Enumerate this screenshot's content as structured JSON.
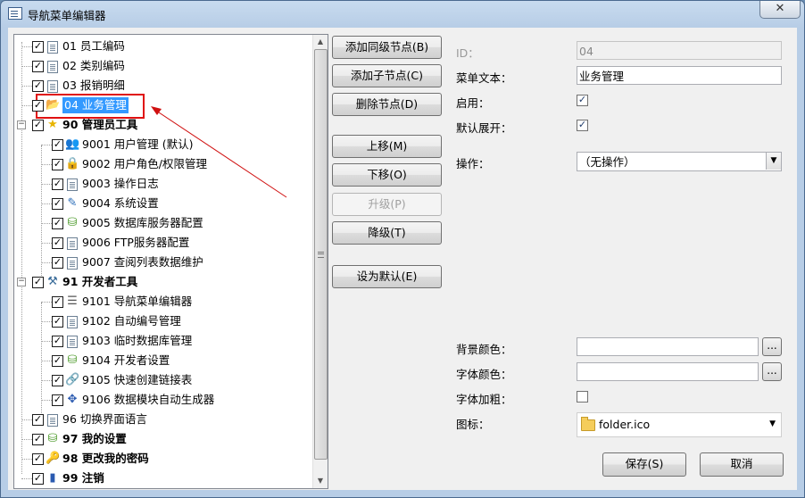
{
  "window": {
    "title": "导航菜单编辑器",
    "close_glyph": "✕"
  },
  "tree": {
    "items": [
      {
        "label": "01 员工编码",
        "checked": true,
        "icon": "document-icon",
        "bold": false
      },
      {
        "label": "02 类别编码",
        "checked": true,
        "icon": "document-icon",
        "bold": false
      },
      {
        "label": "03 报销明细",
        "checked": true,
        "icon": "document-icon",
        "bold": false
      },
      {
        "label": "04 业务管理",
        "checked": true,
        "icon": "folder-open-icon",
        "bold": false,
        "selected": true
      },
      {
        "label": "90 管理员工具",
        "checked": true,
        "icon": "star-icon",
        "bold": true,
        "expander": "−"
      },
      {
        "label": "9001 用户管理 (默认)",
        "checked": true,
        "icon": "users-icon",
        "bold": false
      },
      {
        "label": "9002 用户角色/权限管理",
        "checked": true,
        "icon": "lock-icon",
        "bold": false
      },
      {
        "label": "9003 操作日志",
        "checked": true,
        "icon": "document-icon",
        "bold": false
      },
      {
        "label": "9004 系统设置",
        "checked": true,
        "icon": "edit-icon",
        "bold": false
      },
      {
        "label": "9005 数据库服务器配置",
        "checked": true,
        "icon": "db-icon",
        "bold": false
      },
      {
        "label": "9006 FTP服务器配置",
        "checked": true,
        "icon": "document-icon",
        "bold": false
      },
      {
        "label": "9007 查阅列表数据维护",
        "checked": true,
        "icon": "document-icon",
        "bold": false
      },
      {
        "label": "91 开发者工具",
        "checked": true,
        "icon": "tools-icon",
        "bold": true,
        "expander": "−"
      },
      {
        "label": "9101 导航菜单编辑器",
        "checked": true,
        "icon": "list-icon",
        "bold": false
      },
      {
        "label": "9102 自动编号管理",
        "checked": true,
        "icon": "document-icon",
        "bold": false
      },
      {
        "label": "9103 临时数据库管理",
        "checked": true,
        "icon": "document-icon",
        "bold": false
      },
      {
        "label": "9104 开发者设置",
        "checked": true,
        "icon": "db-icon",
        "bold": false
      },
      {
        "label": "9105 快速创建链接表",
        "checked": true,
        "icon": "link-icon",
        "bold": false
      },
      {
        "label": "9106 数据模块自动生成器",
        "checked": true,
        "icon": "cursor-icon",
        "bold": false
      },
      {
        "label": "96 切换界面语言",
        "checked": true,
        "icon": "document-icon",
        "bold": false
      },
      {
        "label": "97 我的设置",
        "checked": true,
        "icon": "db-icon",
        "bold": true
      },
      {
        "label": "98 更改我的密码",
        "checked": true,
        "icon": "key-icon",
        "bold": true
      },
      {
        "label": "99 注销",
        "checked": true,
        "icon": "exit-icon",
        "bold": true
      }
    ]
  },
  "buttons": {
    "add_sibling": "添加同级节点(B)",
    "add_child": "添加子节点(C)",
    "delete_node": "删除节点(D)",
    "move_up": "上移(M)",
    "move_down": "下移(O)",
    "promote": "升级(P)",
    "demote": "降级(T)",
    "set_default": "设为默认(E)",
    "save": "保存(S)",
    "cancel": "取消"
  },
  "props": {
    "id_label": "ID：",
    "id_value": "04",
    "text_label": "菜单文本：",
    "text_value": "业务管理",
    "enabled_label": "启用：",
    "enabled": true,
    "expand_label": "默认展开：",
    "expanded": true,
    "action_label": "操作：",
    "action_value": "（无操作）",
    "bgcolor_label": "背景颜色：",
    "bgcolor_value": "",
    "fontcolor_label": "字体颜色：",
    "fontcolor_value": "",
    "bold_label": "字体加粗：",
    "bold": false,
    "icon_label": "图标：",
    "icon_value": "folder.ico",
    "ellipsis": "..."
  },
  "scroll": {
    "up": "▲",
    "down": "▼"
  },
  "colors": {
    "selection": "#3399ff",
    "highlight_box": "#e01010",
    "annotation_arrow": "#d01010"
  }
}
